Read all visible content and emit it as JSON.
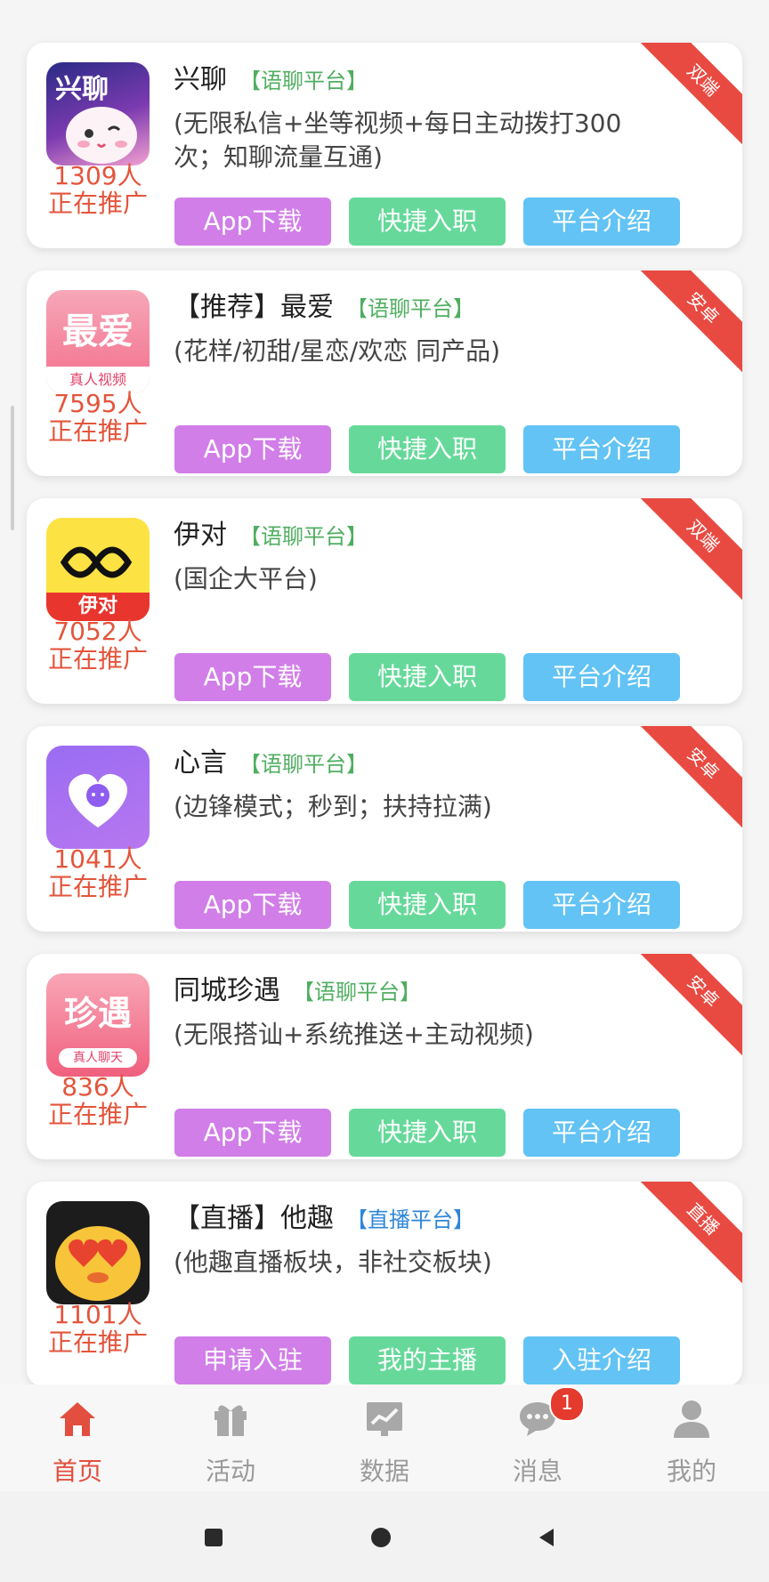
{
  "cards": [
    {
      "name": "兴聊",
      "tag": "【语聊平台】",
      "desc": "(无限私信+坐等视频+每日主动拨打300次；知聊流量互通)",
      "count": "1309人",
      "promo": "正在推广",
      "b1": "App下载",
      "b2": "快捷入职",
      "b3": "平台介绍",
      "ribbon": "双端",
      "logo_text": "兴聊"
    },
    {
      "name": "【推荐】最爱",
      "tag": "【语聊平台】",
      "desc": "(花样/初甜/星恋/欢恋 同产品)",
      "count": "7595人",
      "promo": "正在推广",
      "b1": "App下载",
      "b2": "快捷入职",
      "b3": "平台介绍",
      "ribbon": "安卓",
      "logo_text": "最爱",
      "logo_sub": "真人视频"
    },
    {
      "name": "伊对",
      "tag": "【语聊平台】",
      "desc": "(国企大平台)",
      "count": "7052人",
      "promo": "正在推广",
      "b1": "App下载",
      "b2": "快捷入职",
      "b3": "平台介绍",
      "ribbon": "双端",
      "logo_text": "伊对"
    },
    {
      "name": "心言",
      "tag": "【语聊平台】",
      "desc": "(边锋模式；秒到；扶持拉满)",
      "count": "1041人",
      "promo": "正在推广",
      "b1": "App下载",
      "b2": "快捷入职",
      "b3": "平台介绍",
      "ribbon": "安卓"
    },
    {
      "name": "同城珍遇",
      "tag": "【语聊平台】",
      "desc": "(无限搭讪+系统推送+主动视频)",
      "count": "836人",
      "promo": "正在推广",
      "b1": "App下载",
      "b2": "快捷入职",
      "b3": "平台介绍",
      "ribbon": "安卓",
      "logo_text": "珍遇",
      "logo_sub": "真人聊天"
    },
    {
      "name": "【直播】他趣",
      "tag": "【直播平台】",
      "desc": "(他趣直播板块，非社交板块)",
      "count": "1101人",
      "promo": "正在推广",
      "b1": "申请入驻",
      "b2": "我的主播",
      "b3": "入驻介绍",
      "ribbon": "直播"
    }
  ],
  "nav": [
    {
      "label": "首页",
      "icon": "home-icon"
    },
    {
      "label": "活动",
      "icon": "gift-icon"
    },
    {
      "label": "数据",
      "icon": "chart-icon"
    },
    {
      "label": "消息",
      "icon": "chat-icon",
      "badge": "1"
    },
    {
      "label": "我的",
      "icon": "user-icon"
    }
  ],
  "colors": {
    "accent": "#e34f3f",
    "tag_green": "#4fae60",
    "tag_blue": "#2e86d8",
    "btn_purple": "#d17ee8",
    "btn_green": "#66d99a",
    "btn_blue": "#62c3f4",
    "ribbon": "#e84a42"
  }
}
